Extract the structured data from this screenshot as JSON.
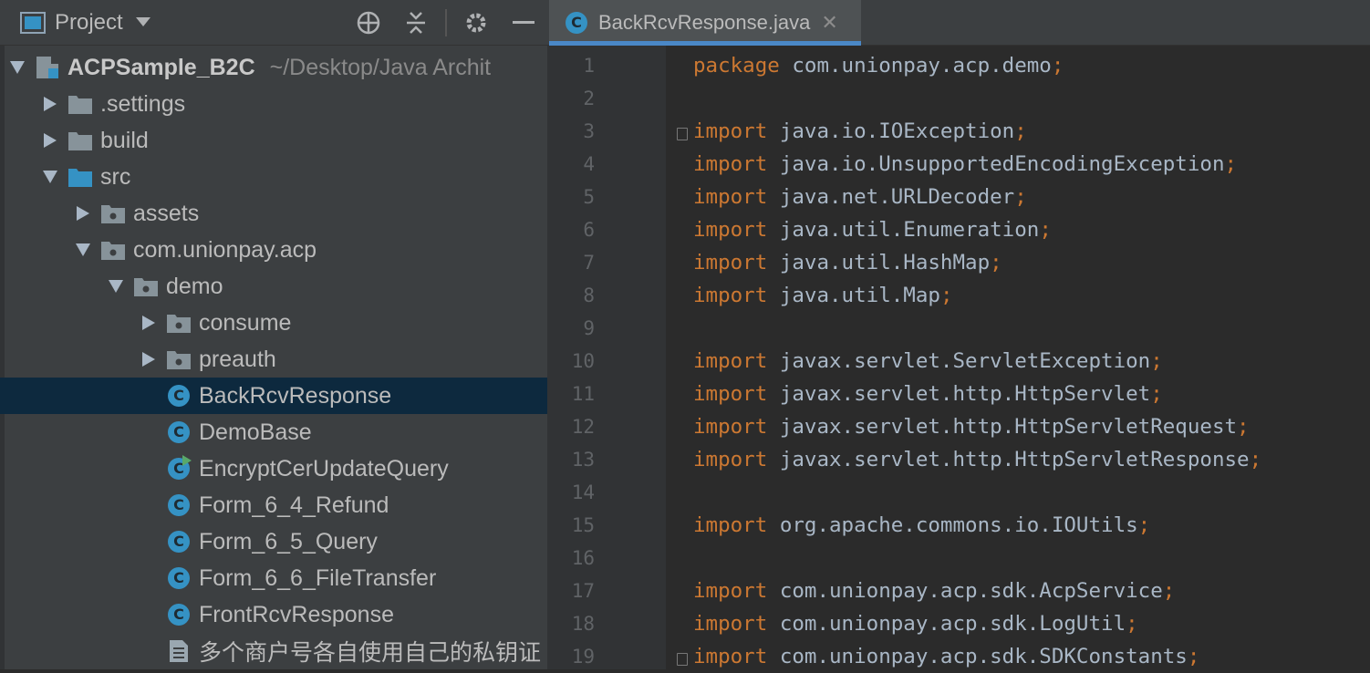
{
  "project_panel": {
    "title": "Project",
    "header_icons": [
      "dropdown-caret-icon",
      "locate-crosshair-icon",
      "collapse-all-icon",
      "gear-icon",
      "minimize-icon"
    ],
    "tree": [
      {
        "label": "ACPSample_B2C",
        "hint": "~/Desktop/Java Archit",
        "arrow": "down",
        "icon": "module-icon",
        "depth": 0
      },
      {
        "label": ".settings",
        "arrow": "right",
        "icon": "folder-icon",
        "depth": 1
      },
      {
        "label": "build",
        "arrow": "right",
        "icon": "folder-icon",
        "depth": 1
      },
      {
        "label": "src",
        "arrow": "down",
        "icon": "source-folder-icon",
        "depth": 1
      },
      {
        "label": "assets",
        "arrow": "right",
        "icon": "package-icon",
        "depth": 2
      },
      {
        "label": "com.unionpay.acp",
        "arrow": "down",
        "icon": "package-icon",
        "depth": 2
      },
      {
        "label": "demo",
        "arrow": "down",
        "icon": "package-icon",
        "depth": 3
      },
      {
        "label": "consume",
        "arrow": "right",
        "icon": "package-icon",
        "depth": 4
      },
      {
        "label": "preauth",
        "arrow": "right",
        "icon": "package-icon",
        "depth": 4
      },
      {
        "label": "BackRcvResponse",
        "arrow": "none",
        "icon": "class-icon",
        "depth": 4,
        "selected": true
      },
      {
        "label": "DemoBase",
        "arrow": "none",
        "icon": "class-icon",
        "depth": 4
      },
      {
        "label": "EncryptCerUpdateQuery",
        "arrow": "none",
        "icon": "runnable-class-icon",
        "depth": 4
      },
      {
        "label": "Form_6_4_Refund",
        "arrow": "none",
        "icon": "class-icon",
        "depth": 4
      },
      {
        "label": "Form_6_5_Query",
        "arrow": "none",
        "icon": "class-icon",
        "depth": 4
      },
      {
        "label": "Form_6_6_FileTransfer",
        "arrow": "none",
        "icon": "class-icon",
        "depth": 4
      },
      {
        "label": "FrontRcvResponse",
        "arrow": "none",
        "icon": "class-icon",
        "depth": 4
      },
      {
        "label": "多个商户号各自使用自己的私钥证",
        "arrow": "none",
        "icon": "text-file-icon",
        "depth": 4
      }
    ]
  },
  "editor": {
    "tab": {
      "title": "BackRcvResponse.java",
      "icon": "class-icon",
      "close": "✕"
    },
    "lines": [
      {
        "n": "1",
        "kw": "package",
        "rest": "com.unionpay.acp.demo",
        "semi": ";"
      },
      {
        "n": "2",
        "kw": "",
        "rest": "",
        "semi": ""
      },
      {
        "n": "3",
        "kw": "import",
        "rest": "java.io.IOException",
        "semi": ";"
      },
      {
        "n": "4",
        "kw": "import",
        "rest": "java.io.UnsupportedEncodingException",
        "semi": ";"
      },
      {
        "n": "5",
        "kw": "import",
        "rest": "java.net.URLDecoder",
        "semi": ";"
      },
      {
        "n": "6",
        "kw": "import",
        "rest": "java.util.Enumeration",
        "semi": ";"
      },
      {
        "n": "7",
        "kw": "import",
        "rest": "java.util.HashMap",
        "semi": ";"
      },
      {
        "n": "8",
        "kw": "import",
        "rest": "java.util.Map",
        "semi": ";"
      },
      {
        "n": "9",
        "kw": "",
        "rest": "",
        "semi": ""
      },
      {
        "n": "10",
        "kw": "import",
        "rest": "javax.servlet.ServletException",
        "semi": ";"
      },
      {
        "n": "11",
        "kw": "import",
        "rest": "javax.servlet.http.HttpServlet",
        "semi": ";"
      },
      {
        "n": "12",
        "kw": "import",
        "rest": "javax.servlet.http.HttpServletRequest",
        "semi": ";"
      },
      {
        "n": "13",
        "kw": "import",
        "rest": "javax.servlet.http.HttpServletResponse",
        "semi": ";"
      },
      {
        "n": "14",
        "kw": "",
        "rest": "",
        "semi": ""
      },
      {
        "n": "15",
        "kw": "import",
        "rest": "org.apache.commons.io.IOUtils",
        "semi": ";"
      },
      {
        "n": "16",
        "kw": "",
        "rest": "",
        "semi": ""
      },
      {
        "n": "17",
        "kw": "import",
        "rest": "com.unionpay.acp.sdk.AcpService",
        "semi": ";"
      },
      {
        "n": "18",
        "kw": "import",
        "rest": "com.unionpay.acp.sdk.LogUtil",
        "semi": ";"
      },
      {
        "n": "19",
        "kw": "import",
        "rest": "com.unionpay.acp.sdk.SDKConstants",
        "semi": ";"
      }
    ]
  },
  "colors": {
    "keyword": "#cc7832",
    "code_text": "#a9b7c6",
    "selection": "#0d293e",
    "class_icon": "#3592c4",
    "tab_underline": "#4a88c7"
  }
}
